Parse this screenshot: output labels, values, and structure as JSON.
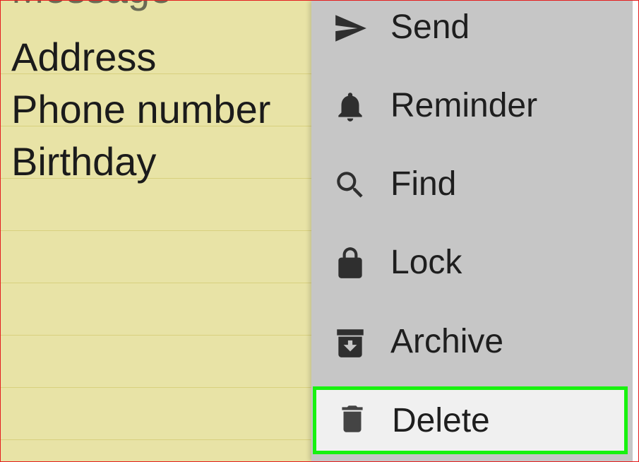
{
  "note": {
    "cut_line": "Message",
    "lines": [
      "Address",
      "Phone number",
      "Birthday"
    ]
  },
  "menu": {
    "items": [
      {
        "label": "Send",
        "icon": "send-icon"
      },
      {
        "label": "Reminder",
        "icon": "bell-icon"
      },
      {
        "label": "Find",
        "icon": "search-icon"
      },
      {
        "label": "Lock",
        "icon": "lock-icon"
      },
      {
        "label": "Archive",
        "icon": "archive-icon"
      },
      {
        "label": "Delete",
        "icon": "trash-icon",
        "highlighted": true
      }
    ]
  },
  "colors": {
    "note_background": "#e8e3a6",
    "menu_background": "#c6c6c6",
    "highlight_border": "#17f20f",
    "frame_border": "#e41e1e"
  }
}
